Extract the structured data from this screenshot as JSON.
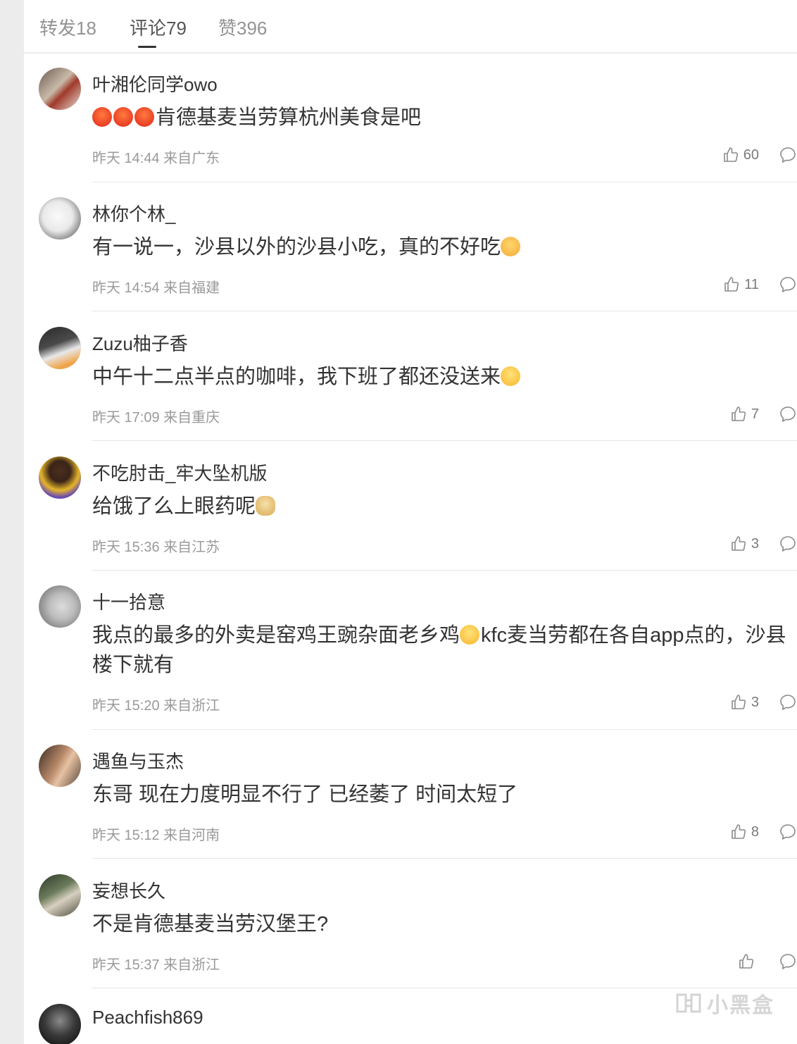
{
  "tabs": [
    {
      "label": "转发18"
    },
    {
      "label": "评论79"
    },
    {
      "label": "赞396"
    }
  ],
  "comments": [
    {
      "user": "叶湘伦同学owo",
      "text": "肯德基麦当劳算杭州美食是吧",
      "meta": "昨天 14:44 来自广东",
      "likes": "60"
    },
    {
      "user": "林你个林_",
      "text": "有一说一，沙县以外的沙县小吃，真的不好吃",
      "meta": "昨天 14:54 来自福建",
      "likes": "11"
    },
    {
      "user": "Zuzu柚子香",
      "text": "中午十二点半点的咖啡，我下班了都还没送来",
      "meta": "昨天 17:09 来自重庆",
      "likes": "7"
    },
    {
      "user": "不吃肘击_牢大坠机版",
      "text": "给饿了么上眼药呢",
      "meta": "昨天 15:36 来自江苏",
      "likes": "3"
    },
    {
      "user": "十一拾意",
      "text_a": "我点的最多的外卖是窑鸡王豌杂面老乡鸡",
      "text_b": "kfc麦当劳都在各自app点的，沙县楼下就有",
      "meta": "昨天 15:20 来自浙江",
      "likes": "3"
    },
    {
      "user": "遇鱼与玉杰",
      "text": "东哥 现在力度明显不行了 已经萎了 时间太短了",
      "meta": "昨天 15:12 来自河南",
      "likes": "8"
    },
    {
      "user": "妄想长久",
      "text": "不是肯德基麦当劳汉堡王?",
      "meta": "昨天 15:37 来自浙江",
      "likes": ""
    },
    {
      "user": "Peachfish869"
    }
  ],
  "watermark": {
    "text": "小黑盒"
  },
  "colors": {
    "text": "#333333",
    "meta": "#9a9a9a",
    "divider": "#e6e6e6",
    "sidebar": "#ececec"
  }
}
